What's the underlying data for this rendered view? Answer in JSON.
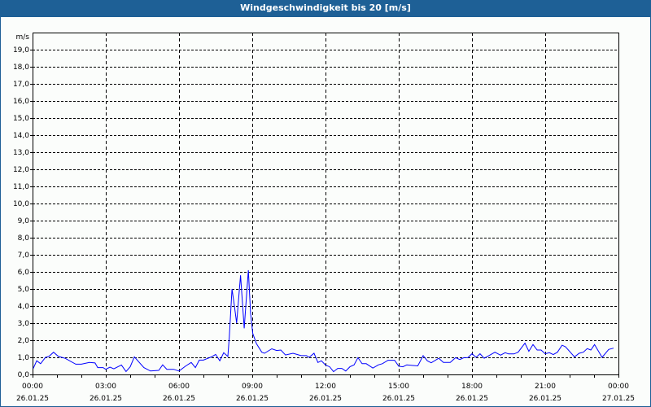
{
  "title": "Windgeschwindigkeit bis 20 [m/s]",
  "chart_data": {
    "type": "line",
    "title": "Windgeschwindigkeit bis 20 [m/s]",
    "ylabel": "m/s",
    "xlabel": "",
    "ylim": [
      0,
      20
    ],
    "xlim_hours": [
      0,
      24
    ],
    "y_ticks": [
      "0,0",
      "1,0",
      "2,0",
      "3,0",
      "4,0",
      "5,0",
      "6,0",
      "7,0",
      "8,0",
      "9,0",
      "10,0",
      "11,0",
      "12,0",
      "13,0",
      "14,0",
      "15,0",
      "16,0",
      "17,0",
      "18,0",
      "19,0"
    ],
    "x_ticks": [
      {
        "time": "00:00",
        "date": "26.01.25",
        "hour": 0
      },
      {
        "time": "03:00",
        "date": "26.01.25",
        "hour": 3
      },
      {
        "time": "06:00",
        "date": "26.01.25",
        "hour": 6
      },
      {
        "time": "09:00",
        "date": "26.01.25",
        "hour": 9
      },
      {
        "time": "12:00",
        "date": "26.01.25",
        "hour": 12
      },
      {
        "time": "15:00",
        "date": "26.01.25",
        "hour": 15
      },
      {
        "time": "18:00",
        "date": "26.01.25",
        "hour": 18
      },
      {
        "time": "21:00",
        "date": "26.01.25",
        "hour": 21
      },
      {
        "time": "00:00",
        "date": "27.01.25",
        "hour": 24
      }
    ],
    "grid": true,
    "line_color": "#0000ff",
    "series": [
      {
        "name": "Windgeschwindigkeit",
        "hours": [
          0.03,
          0.17,
          0.33,
          0.53,
          0.67,
          0.86,
          1.06,
          1.33,
          1.77,
          2.0,
          2.33,
          2.56,
          2.67,
          2.89,
          3.0,
          3.17,
          3.33,
          3.64,
          3.83,
          4.0,
          4.17,
          4.56,
          4.83,
          5.17,
          5.33,
          5.5,
          5.78,
          6.0,
          6.28,
          6.5,
          6.67,
          6.83,
          7.0,
          7.33,
          7.5,
          7.67,
          7.83,
          8.0,
          8.06,
          8.17,
          8.26,
          8.36,
          8.52,
          8.67,
          8.84,
          8.93,
          9.02,
          9.17,
          9.39,
          9.5,
          9.8,
          10.0,
          10.17,
          10.36,
          10.67,
          11.0,
          11.22,
          11.33,
          11.53,
          11.69,
          11.83,
          12.0,
          12.17,
          12.33,
          12.5,
          12.67,
          12.83,
          13.0,
          13.17,
          13.33,
          13.5,
          13.67,
          13.94,
          14.17,
          14.33,
          14.56,
          14.83,
          15.0,
          15.17,
          15.33,
          15.78,
          16.0,
          16.17,
          16.33,
          16.64,
          16.83,
          17.11,
          17.33,
          17.5,
          17.67,
          17.83,
          18.0,
          18.17,
          18.33,
          18.5,
          18.67,
          18.94,
          19.17,
          19.36,
          19.5,
          19.72,
          19.89,
          20.17,
          20.33,
          20.5,
          20.67,
          20.83,
          21.0,
          21.17,
          21.33,
          21.5,
          21.69,
          21.83,
          22.2,
          22.39,
          22.56,
          22.72,
          22.87,
          23.02,
          23.33,
          23.6,
          23.8
        ],
        "values": [
          0.35,
          0.8,
          0.63,
          1.0,
          1.05,
          1.3,
          1.05,
          0.95,
          0.6,
          0.6,
          0.7,
          0.67,
          0.4,
          0.4,
          0.3,
          0.43,
          0.33,
          0.55,
          0.17,
          0.45,
          1.03,
          0.4,
          0.2,
          0.24,
          0.56,
          0.3,
          0.3,
          0.2,
          0.5,
          0.7,
          0.4,
          0.84,
          0.84,
          1.03,
          1.17,
          0.8,
          1.27,
          1.05,
          2.2,
          5.0,
          4.1,
          3.0,
          5.8,
          2.7,
          6.1,
          3.6,
          2.4,
          1.8,
          1.3,
          1.24,
          1.5,
          1.4,
          1.43,
          1.14,
          1.24,
          1.1,
          1.1,
          1.0,
          1.24,
          0.7,
          0.8,
          0.55,
          0.45,
          0.16,
          0.35,
          0.35,
          0.2,
          0.45,
          0.56,
          0.98,
          0.63,
          0.63,
          0.37,
          0.56,
          0.63,
          0.83,
          0.83,
          0.48,
          0.45,
          0.56,
          0.5,
          1.1,
          0.8,
          0.68,
          0.95,
          0.7,
          0.7,
          0.98,
          0.87,
          0.98,
          0.98,
          1.21,
          1.0,
          1.21,
          0.95,
          1.08,
          1.3,
          1.13,
          1.27,
          1.2,
          1.2,
          1.3,
          1.83,
          1.35,
          1.75,
          1.43,
          1.43,
          1.21,
          1.27,
          1.16,
          1.3,
          1.71,
          1.62,
          1.03,
          1.24,
          1.3,
          1.51,
          1.43,
          1.75,
          1.0,
          1.46,
          1.54
        ]
      }
    ]
  }
}
